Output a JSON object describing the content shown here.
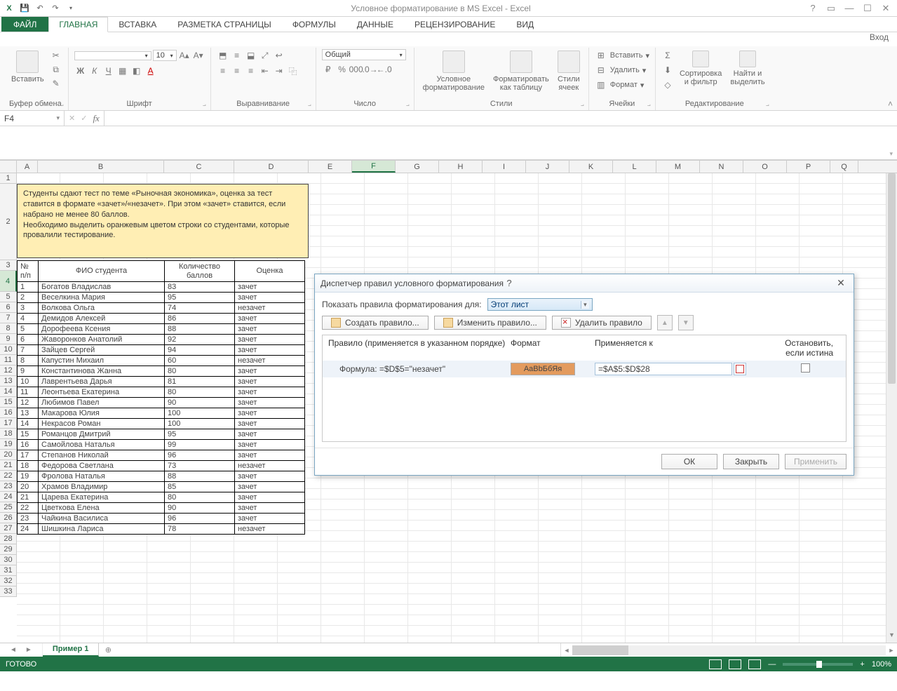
{
  "titlebar": {
    "title": "Условное форматирование в MS Excel - Excel",
    "signin": "Вход"
  },
  "tabs": {
    "file": "ФАЙЛ",
    "list": [
      "ГЛАВНАЯ",
      "ВСТАВКА",
      "РАЗМЕТКА СТРАНИЦЫ",
      "ФОРМУЛЫ",
      "ДАННЫЕ",
      "РЕЦЕНЗИРОВАНИЕ",
      "ВИД"
    ],
    "active": 0
  },
  "ribbon": {
    "clipboard": {
      "paste": "Вставить",
      "label": "Буфер обмена"
    },
    "font": {
      "name": "",
      "size": "10",
      "label": "Шрифт"
    },
    "align": {
      "label": "Выравнивание"
    },
    "number": {
      "format": "Общий",
      "label": "Число"
    },
    "styles": {
      "cond": "Условное\nформатирование",
      "table": "Форматировать\nкак таблицу",
      "cell": "Стили\nячеек",
      "label": "Стили"
    },
    "cells": {
      "insert": "Вставить",
      "delete": "Удалить",
      "format": "Формат",
      "label": "Ячейки"
    },
    "editing": {
      "sort": "Сортировка\nи фильтр",
      "find": "Найти и\nвыделить",
      "label": "Редактирование"
    }
  },
  "namebox": "F4",
  "columns": [
    "A",
    "B",
    "C",
    "D",
    "E",
    "F",
    "G",
    "H",
    "I",
    "J",
    "K",
    "L",
    "M",
    "N",
    "O",
    "P",
    "Q"
  ],
  "note": "Студенты сдают тест по теме «Рыночная экономика», оценка за тест ставится в формате «зачет»/«незачет». При этом «зачет» ставится, если набрано не менее 80 баллов.\nНеобходимо выделить оранжевым цветом строки со студентами, которые провалили тестирование.",
  "headers": {
    "no": "№ п/п",
    "fio": "ФИО студента",
    "score": "Количество баллов",
    "grade": "Оценка"
  },
  "rows": [
    {
      "n": "1",
      "fio": "Богатов Владислав",
      "score": "83",
      "grade": "зачет"
    },
    {
      "n": "2",
      "fio": "Веселкина Мария",
      "score": "95",
      "grade": "зачет"
    },
    {
      "n": "3",
      "fio": "Волкова Ольга",
      "score": "74",
      "grade": "незачет"
    },
    {
      "n": "4",
      "fio": "Демидов Алексей",
      "score": "86",
      "grade": "зачет"
    },
    {
      "n": "5",
      "fio": "Дорофеева Ксения",
      "score": "88",
      "grade": "зачет"
    },
    {
      "n": "6",
      "fio": "Жаворонков Анатолий",
      "score": "92",
      "grade": "зачет"
    },
    {
      "n": "7",
      "fio": "Зайцев Сергей",
      "score": "94",
      "grade": "зачет"
    },
    {
      "n": "8",
      "fio": "Капустин Михаил",
      "score": "60",
      "grade": "незачет"
    },
    {
      "n": "9",
      "fio": "Константинова Жанна",
      "score": "80",
      "grade": "зачет"
    },
    {
      "n": "10",
      "fio": "Лаврентьева Дарья",
      "score": "81",
      "grade": "зачет"
    },
    {
      "n": "11",
      "fio": "Леонтьева Екатерина",
      "score": "80",
      "grade": "зачет"
    },
    {
      "n": "12",
      "fio": "Любимов Павел",
      "score": "90",
      "grade": "зачет"
    },
    {
      "n": "13",
      "fio": "Макарова Юлия",
      "score": "100",
      "grade": "зачет"
    },
    {
      "n": "14",
      "fio": "Некрасов Роман",
      "score": "100",
      "grade": "зачет"
    },
    {
      "n": "15",
      "fio": "Романцов Дмитрий",
      "score": "95",
      "grade": "зачет"
    },
    {
      "n": "16",
      "fio": "Самойлова Наталья",
      "score": "99",
      "grade": "зачет"
    },
    {
      "n": "17",
      "fio": "Степанов Николай",
      "score": "96",
      "grade": "зачет"
    },
    {
      "n": "18",
      "fio": "Федорова Светлана",
      "score": "73",
      "grade": "незачет"
    },
    {
      "n": "19",
      "fio": "Фролова Наталья",
      "score": "88",
      "grade": "зачет"
    },
    {
      "n": "20",
      "fio": "Храмов Владимир",
      "score": "85",
      "grade": "зачет"
    },
    {
      "n": "21",
      "fio": "Царева Екатерина",
      "score": "80",
      "grade": "зачет"
    },
    {
      "n": "22",
      "fio": "Цветкова Елена",
      "score": "90",
      "grade": "зачет"
    },
    {
      "n": "23",
      "fio": "Чайкина Василиса",
      "score": "96",
      "grade": "зачет"
    },
    {
      "n": "24",
      "fio": "Шишкина Лариса",
      "score": "78",
      "grade": "незачет"
    }
  ],
  "sheet": {
    "name": "Пример 1"
  },
  "status": {
    "ready": "ГОТОВО",
    "zoom": "100%"
  },
  "dialog": {
    "title": "Диспетчер правил условного форматирования",
    "show_label": "Показать правила форматирования для:",
    "scope": "Этот лист",
    "new_rule": "Создать правило...",
    "edit_rule": "Изменить правило...",
    "delete_rule": "Удалить правило",
    "col_rule": "Правило (применяется в указанном порядке)",
    "col_format": "Формат",
    "col_applies": "Применяется к",
    "col_stop": "Остановить, если истина",
    "rule_text": "Формула: =$D$5=\"незачет\"",
    "fmt_sample": "АaВbБбЯя",
    "applies": "=$A$5:$D$28",
    "ok": "ОК",
    "close": "Закрыть",
    "apply": "Применить"
  }
}
